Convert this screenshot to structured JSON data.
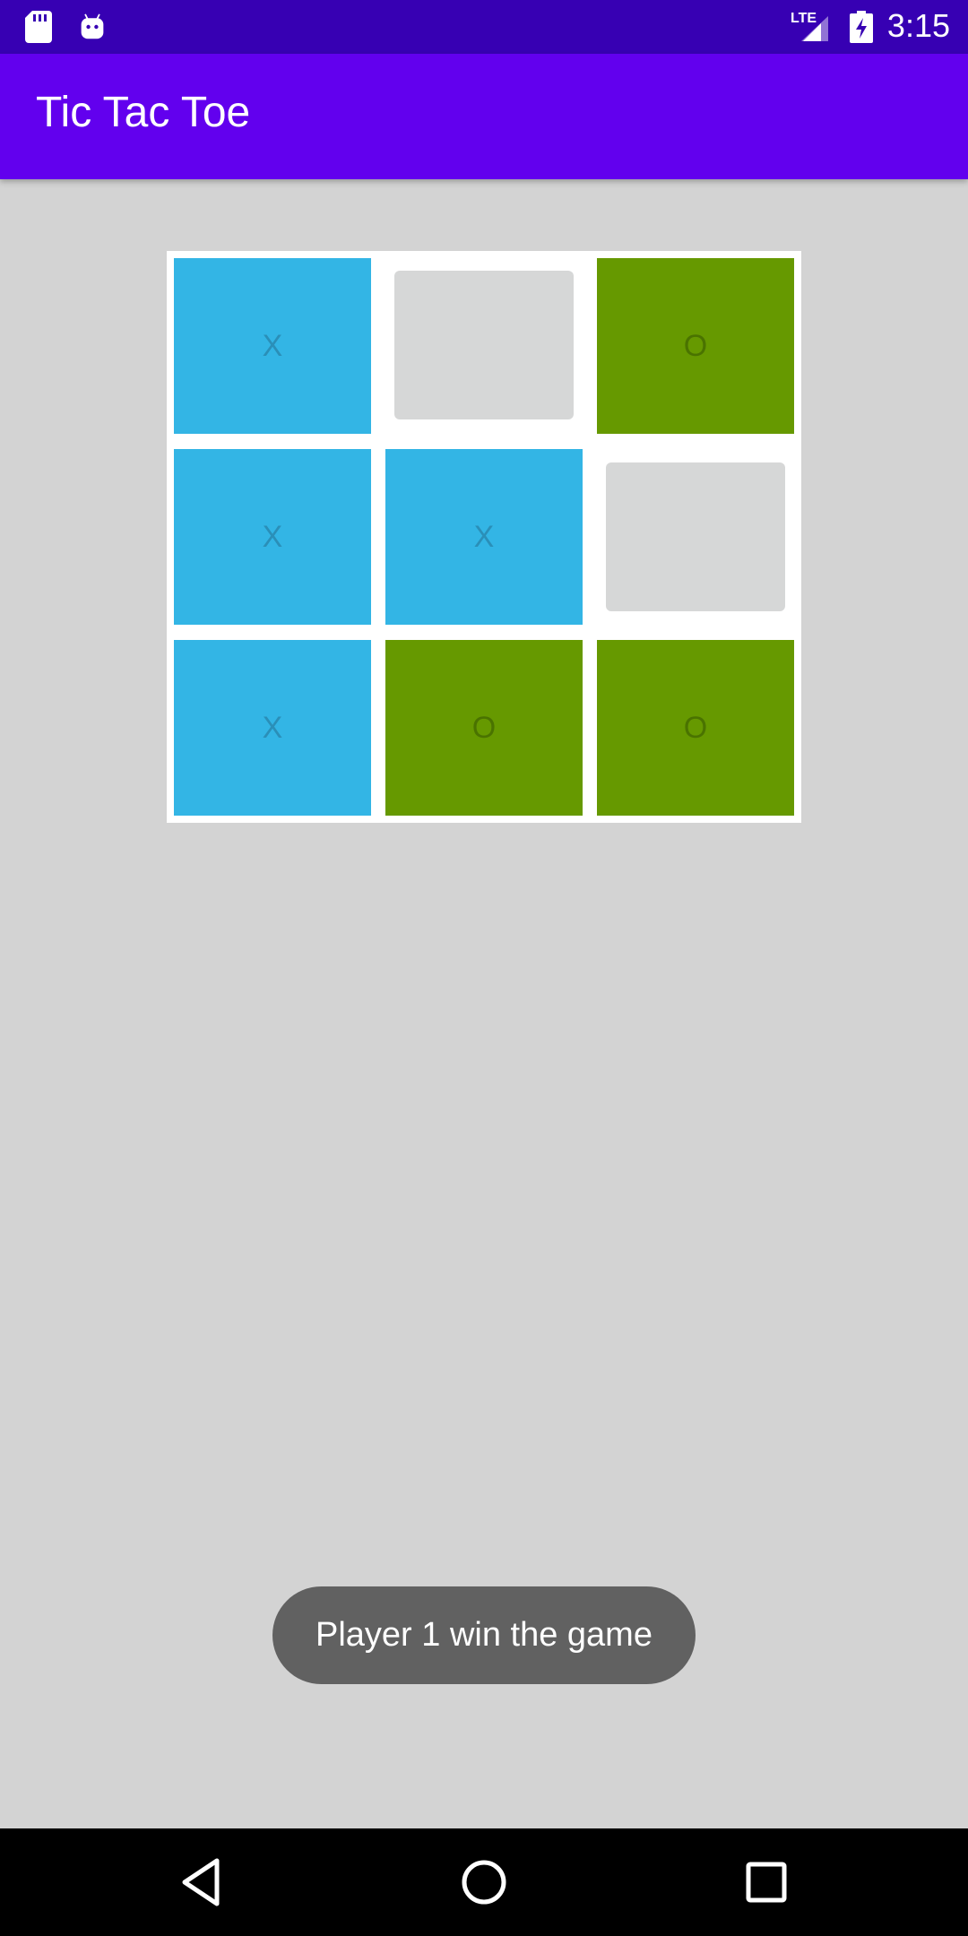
{
  "status_bar": {
    "time": "3:15",
    "icons": [
      "sd-card-icon",
      "android-icon",
      "lte-signal-icon",
      "battery-charging-icon"
    ],
    "network_label": "LTE"
  },
  "app_bar": {
    "title": "Tic Tac Toe"
  },
  "board": {
    "cells": [
      {
        "mark": "X",
        "state": "x"
      },
      {
        "mark": "",
        "state": "empty"
      },
      {
        "mark": "O",
        "state": "o"
      },
      {
        "mark": "X",
        "state": "x"
      },
      {
        "mark": "X",
        "state": "x"
      },
      {
        "mark": "",
        "state": "empty"
      },
      {
        "mark": "X",
        "state": "x"
      },
      {
        "mark": "O",
        "state": "o"
      },
      {
        "mark": "O",
        "state": "o"
      }
    ]
  },
  "toast": {
    "message": "Player 1 win the game"
  },
  "nav_bar": {
    "buttons": [
      "back-icon",
      "home-icon",
      "recents-icon"
    ]
  },
  "colors": {
    "status_bar": "#3700b3",
    "app_bar": "#6200ee",
    "x_cell": "#33b5e5",
    "o_cell": "#669900",
    "empty_cell": "#d6d7d7",
    "background": "#d3d3d3"
  }
}
